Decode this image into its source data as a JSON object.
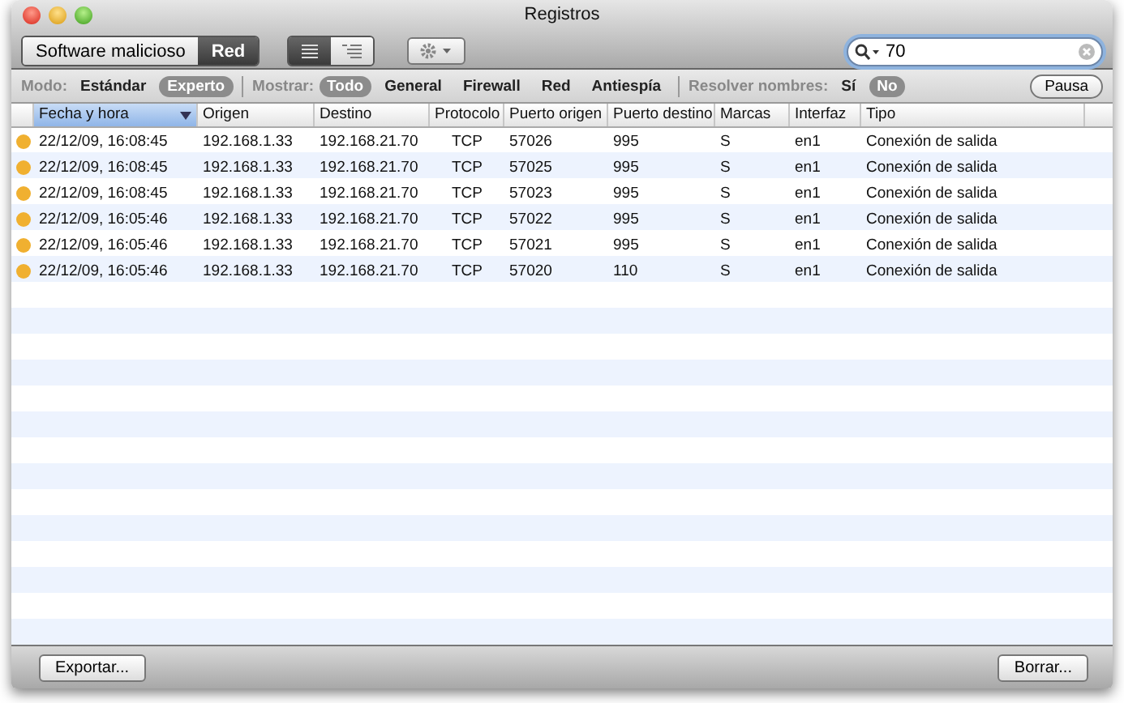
{
  "window": {
    "title": "Registros"
  },
  "segments": [
    {
      "label": "Software malicioso",
      "selected": false
    },
    {
      "label": "Red",
      "selected": true
    }
  ],
  "view_toggle": [
    {
      "kind": "list",
      "selected": true
    },
    {
      "kind": "detail",
      "selected": false
    }
  ],
  "search": {
    "value": "70"
  },
  "filters": [
    {
      "label": "Modo:",
      "options": [
        {
          "label": "Estándar",
          "selected": false
        },
        {
          "label": "Experto",
          "selected": true
        }
      ]
    },
    {
      "label": "Mostrar:",
      "options": [
        {
          "label": "Todo",
          "selected": true
        },
        {
          "label": "General",
          "selected": false
        },
        {
          "label": "Firewall",
          "selected": false
        },
        {
          "label": "Red",
          "selected": false
        },
        {
          "label": "Antiespía",
          "selected": false
        }
      ]
    },
    {
      "label": "Resolver nombres:",
      "options": [
        {
          "label": "Sí",
          "selected": false
        },
        {
          "label": "No",
          "selected": true
        }
      ]
    }
  ],
  "pause_button": "Pausa",
  "table": {
    "columns": [
      {
        "label": "Fecha y hora",
        "sorted": true
      },
      {
        "label": "Origen",
        "sorted": false
      },
      {
        "label": "Destino",
        "sorted": false
      },
      {
        "label": "Protocolo",
        "sorted": false
      },
      {
        "label": "Puerto origen",
        "sorted": false
      },
      {
        "label": "Puerto destino",
        "sorted": false
      },
      {
        "label": "Marcas",
        "sorted": false
      },
      {
        "label": "Interfaz",
        "sorted": false
      },
      {
        "label": "Tipo",
        "sorted": false
      }
    ],
    "rows": [
      {
        "color": "#f0b030",
        "cells": [
          "22/12/09, 16:08:45",
          "192.168.1.33",
          "192.168.21.70",
          "TCP",
          "57026",
          "995",
          "S",
          "en1",
          "Conexión de salida"
        ]
      },
      {
        "color": "#f0b030",
        "cells": [
          "22/12/09, 16:08:45",
          "192.168.1.33",
          "192.168.21.70",
          "TCP",
          "57025",
          "995",
          "S",
          "en1",
          "Conexión de salida"
        ]
      },
      {
        "color": "#f0b030",
        "cells": [
          "22/12/09, 16:08:45",
          "192.168.1.33",
          "192.168.21.70",
          "TCP",
          "57023",
          "995",
          "S",
          "en1",
          "Conexión de salida"
        ]
      },
      {
        "color": "#f0b030",
        "cells": [
          "22/12/09, 16:05:46",
          "192.168.1.33",
          "192.168.21.70",
          "TCP",
          "57022",
          "995",
          "S",
          "en1",
          "Conexión de salida"
        ]
      },
      {
        "color": "#f0b030",
        "cells": [
          "22/12/09, 16:05:46",
          "192.168.1.33",
          "192.168.21.70",
          "TCP",
          "57021",
          "995",
          "S",
          "en1",
          "Conexión de salida"
        ]
      },
      {
        "color": "#f0b030",
        "cells": [
          "22/12/09, 16:05:46",
          "192.168.1.33",
          "192.168.21.70",
          "TCP",
          "57020",
          "110",
          "S",
          "en1",
          "Conexión de salida"
        ]
      }
    ]
  },
  "buttons": [
    "Exportar...",
    "Borrar..."
  ]
}
